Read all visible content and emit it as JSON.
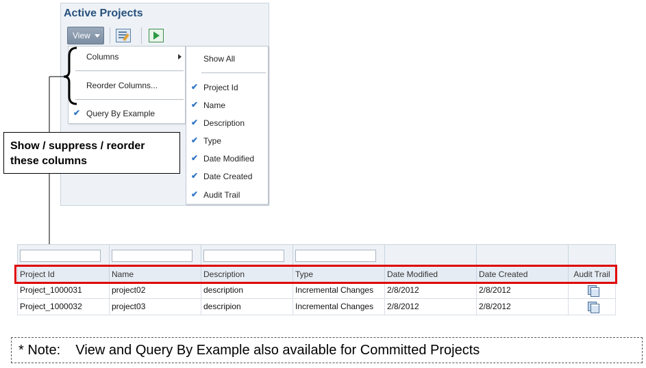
{
  "panel": {
    "title": "Active Projects",
    "view_label": "View"
  },
  "menu": {
    "items": [
      {
        "label": "Columns",
        "checked": false,
        "has_submenu": true
      },
      {
        "label": "Reorder Columns...",
        "checked": false,
        "has_submenu": false
      },
      {
        "label": "Query By Example",
        "checked": true,
        "has_submenu": false
      }
    ]
  },
  "submenu": {
    "show_all": "Show All",
    "columns": [
      {
        "label": "Project Id",
        "checked": true
      },
      {
        "label": "Name",
        "checked": true
      },
      {
        "label": "Description",
        "checked": true
      },
      {
        "label": "Type",
        "checked": true
      },
      {
        "label": "Date Modified",
        "checked": true
      },
      {
        "label": "Date Created",
        "checked": true
      },
      {
        "label": "Audit Trail",
        "checked": true
      }
    ]
  },
  "callout": {
    "line1": "Show / suppress / reorder",
    "line2": "these columns"
  },
  "table": {
    "headers": [
      "Project Id",
      "Name",
      "Description",
      "Type",
      "Date Modified",
      "Date Created",
      "Audit Trail"
    ],
    "rows": [
      [
        "Project_1000031",
        "project02",
        "description",
        "Incremental Changes",
        "2/8/2012",
        "2/8/2012"
      ],
      [
        "Project_1000032",
        "project03",
        "descripion",
        "Incremental Changes",
        "2/8/2012",
        "2/8/2012"
      ]
    ]
  },
  "note": "* Note:    View and Query By Example also available for Committed Projects",
  "colors": {
    "accent": "#25507d",
    "highlight": "#e00000",
    "check": "#2f74c4"
  }
}
